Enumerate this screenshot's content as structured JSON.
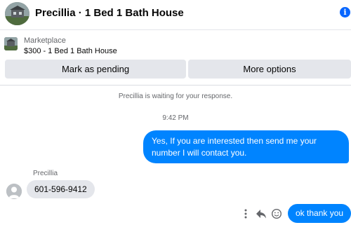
{
  "header": {
    "title": "Precillia · 1 Bed 1 Bath House",
    "avatar": "house-photo",
    "info_icon": "info-icon",
    "info_glyph": "i"
  },
  "listing": {
    "source": "Marketplace",
    "title": "$300 - 1 Bed 1 Bath House",
    "thumb": "house-photo",
    "buttons": {
      "pending": "Mark as pending",
      "more": "More options"
    }
  },
  "conversation": {
    "system_message": "Precillia is waiting for your response.",
    "timestamp": "9:42 PM",
    "messages": [
      {
        "from": "me",
        "text": "Yes, If you are interested then send me your number I will contact you."
      },
      {
        "from": "Precillia",
        "text": "601-596-9412"
      },
      {
        "from": "me",
        "text": "ok thank you"
      }
    ],
    "sender_name": "Precillia"
  },
  "message_actions": [
    "more-icon",
    "reply-icon",
    "react-emoji-icon"
  ],
  "colors": {
    "outgoing_bubble": "#0084ff",
    "incoming_bubble": "#e4e6eb",
    "accent": "#0866ff",
    "secondary_text": "#65676b"
  }
}
